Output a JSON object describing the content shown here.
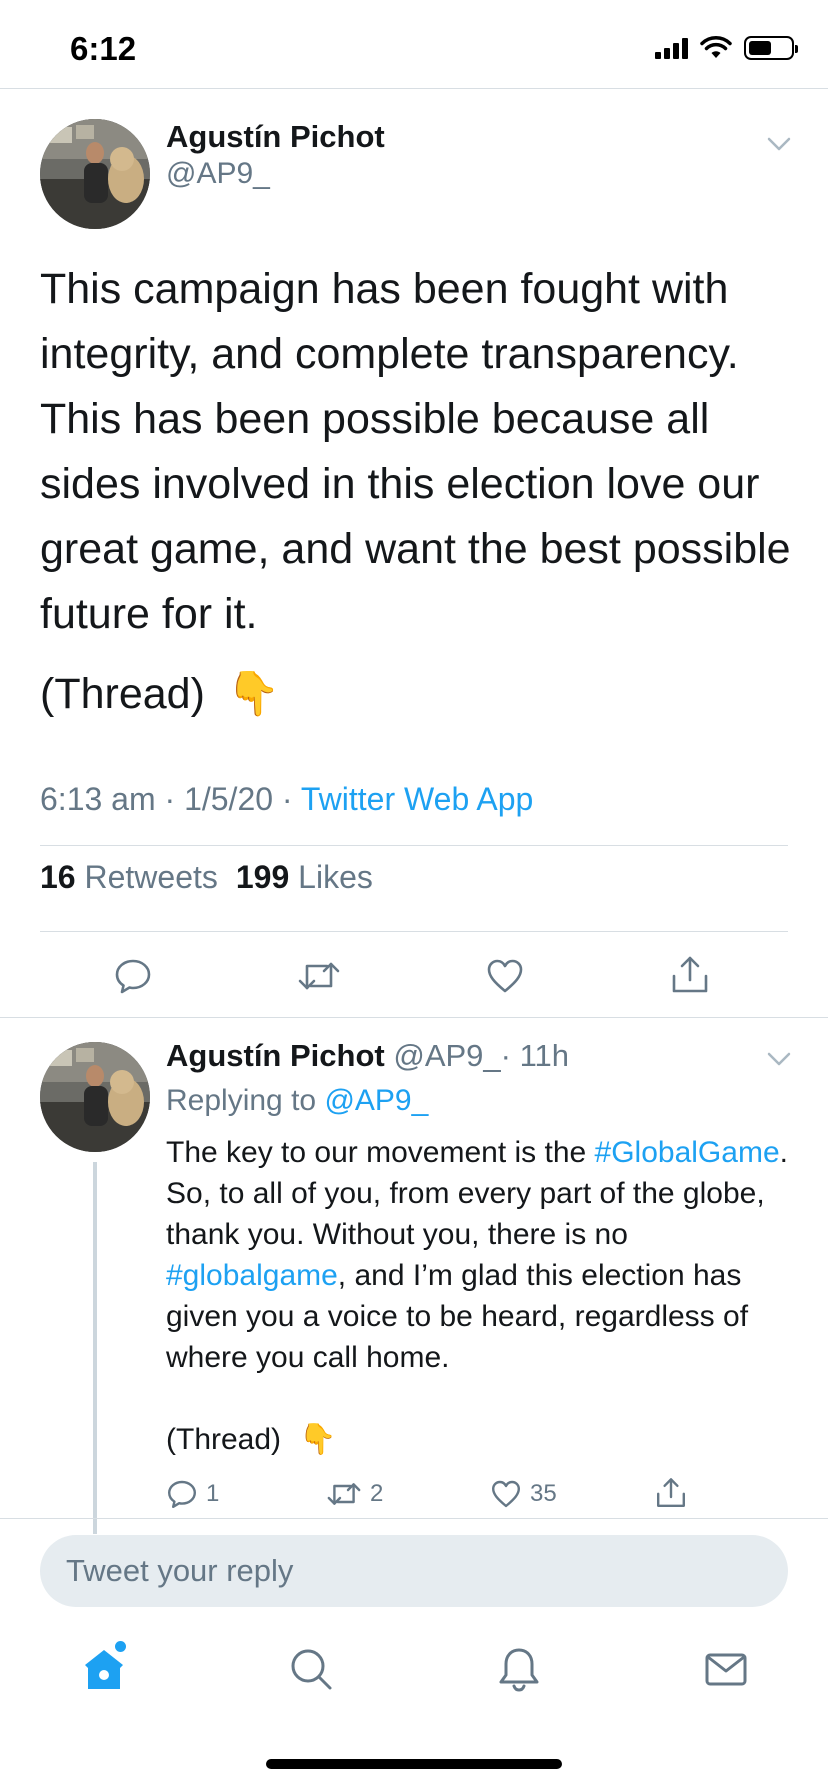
{
  "status_bar": {
    "time": "6:12"
  },
  "main_tweet": {
    "author_name": "Agustín Pichot",
    "author_handle": "@AP9_",
    "body": "This campaign has been fought with integrity, and complete transparency. This has been possible because all sides involved in this election love our great game, and want the best possible future for it.",
    "thread_label": "(Thread)",
    "thread_emoji": "👇",
    "timestamp": "6:13 am · 1/5/20 · ",
    "source": "Twitter Web App",
    "retweets_count": "16",
    "retweets_label": "Retweets",
    "likes_count": "199",
    "likes_label": "Likes"
  },
  "reply_tweet": {
    "author_name": "Agustín Pichot",
    "author_handle": "@AP9_",
    "time_ago": "· 11h",
    "replying_prefix": "Replying to ",
    "replying_handle": "@AP9_",
    "text_1": "The key to our movement is the ",
    "hashtag_1": "#GlobalGame",
    "text_2": ". So, to all of you, from every part of the globe, thank you. Without you, there is no ",
    "hashtag_2": "#globalgame",
    "text_3": ", and I’m glad this election has given you a voice to be heard, regardless of where you call home.",
    "thread_label": "(Thread)",
    "thread_emoji": "👇",
    "reply_count": "1",
    "retweet_count": "2",
    "like_count": "35"
  },
  "compose": {
    "placeholder": "Tweet your reply"
  },
  "colors": {
    "accent": "#1da1f2",
    "muted": "#657786",
    "divider": "#d8dee3",
    "compose_bg": "#e6ecf0"
  },
  "icons": {
    "status": [
      "cellular-signal-icon",
      "wifi-icon",
      "battery-icon"
    ],
    "tweet_actions": [
      "reply-icon",
      "retweet-icon",
      "like-icon",
      "share-icon"
    ],
    "tab_bar": [
      "home-icon",
      "search-icon",
      "notifications-icon",
      "messages-icon"
    ]
  }
}
